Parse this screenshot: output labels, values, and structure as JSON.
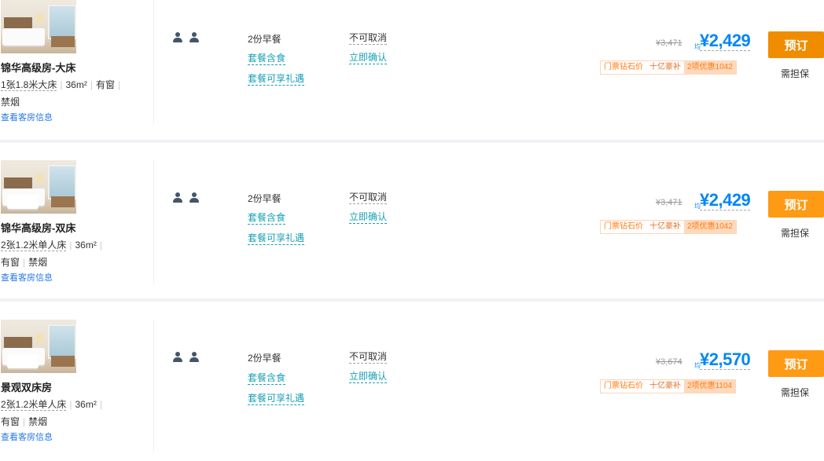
{
  "rooms": [
    {
      "name": "锦华高级房-大床",
      "bed": "1张1.8米大床",
      "area": "36m²",
      "line1_extra": "有窗",
      "line2": [
        "禁烟"
      ],
      "info_link": "查看客房信息",
      "breakfast": "2份早餐",
      "package_meal": "套餐含食",
      "package_perk": "套餐可享礼遇",
      "cancel_policy": "不可取消",
      "confirm": "立即确认",
      "original_price": "¥3,471",
      "avg_label": "均",
      "price": "¥2,429",
      "tags": [
        "门票钻石价",
        "十亿豪补",
        "2项优惠1042"
      ],
      "book_label": "预订",
      "guarantee": "需担保"
    },
    {
      "name": "锦华高级房-双床",
      "bed": "2张1.2米单人床",
      "area": "36m²",
      "line1_extra": "",
      "line2": [
        "有窗",
        "禁烟"
      ],
      "info_link": "查看客房信息",
      "breakfast": "2份早餐",
      "package_meal": "套餐含食",
      "package_perk": "套餐可享礼遇",
      "cancel_policy": "不可取消",
      "confirm": "立即确认",
      "original_price": "¥3,471",
      "avg_label": "均",
      "price": "¥2,429",
      "tags": [
        "门票钻石价",
        "十亿豪补",
        "2项优惠1042"
      ],
      "book_label": "预订",
      "guarantee": "需担保"
    },
    {
      "name": "景观双床房",
      "bed": "2张1.2米单人床",
      "area": "36m²",
      "line1_extra": "",
      "line2": [
        "有窗",
        "禁烟"
      ],
      "info_link": "查看客房信息",
      "breakfast": "2份早餐",
      "package_meal": "套餐含食",
      "package_perk": "套餐可享礼遇",
      "cancel_policy": "不可取消",
      "confirm": "立即确认",
      "original_price": "¥3,674",
      "avg_label": "均",
      "price": "¥2,570",
      "tags": [
        "门票钻石价",
        "十亿豪补",
        "2项优惠1104"
      ],
      "book_label": "预订",
      "guarantee": "需担保"
    }
  ],
  "colors": {
    "price": "#0086f6",
    "book_button": "#ff9a14",
    "book_button_first": "#f08c00",
    "link": "#2577e3",
    "teal_link": "#18a0b4",
    "tag_text": "#ff7d13"
  },
  "icons": {
    "guests": "person-icon"
  }
}
